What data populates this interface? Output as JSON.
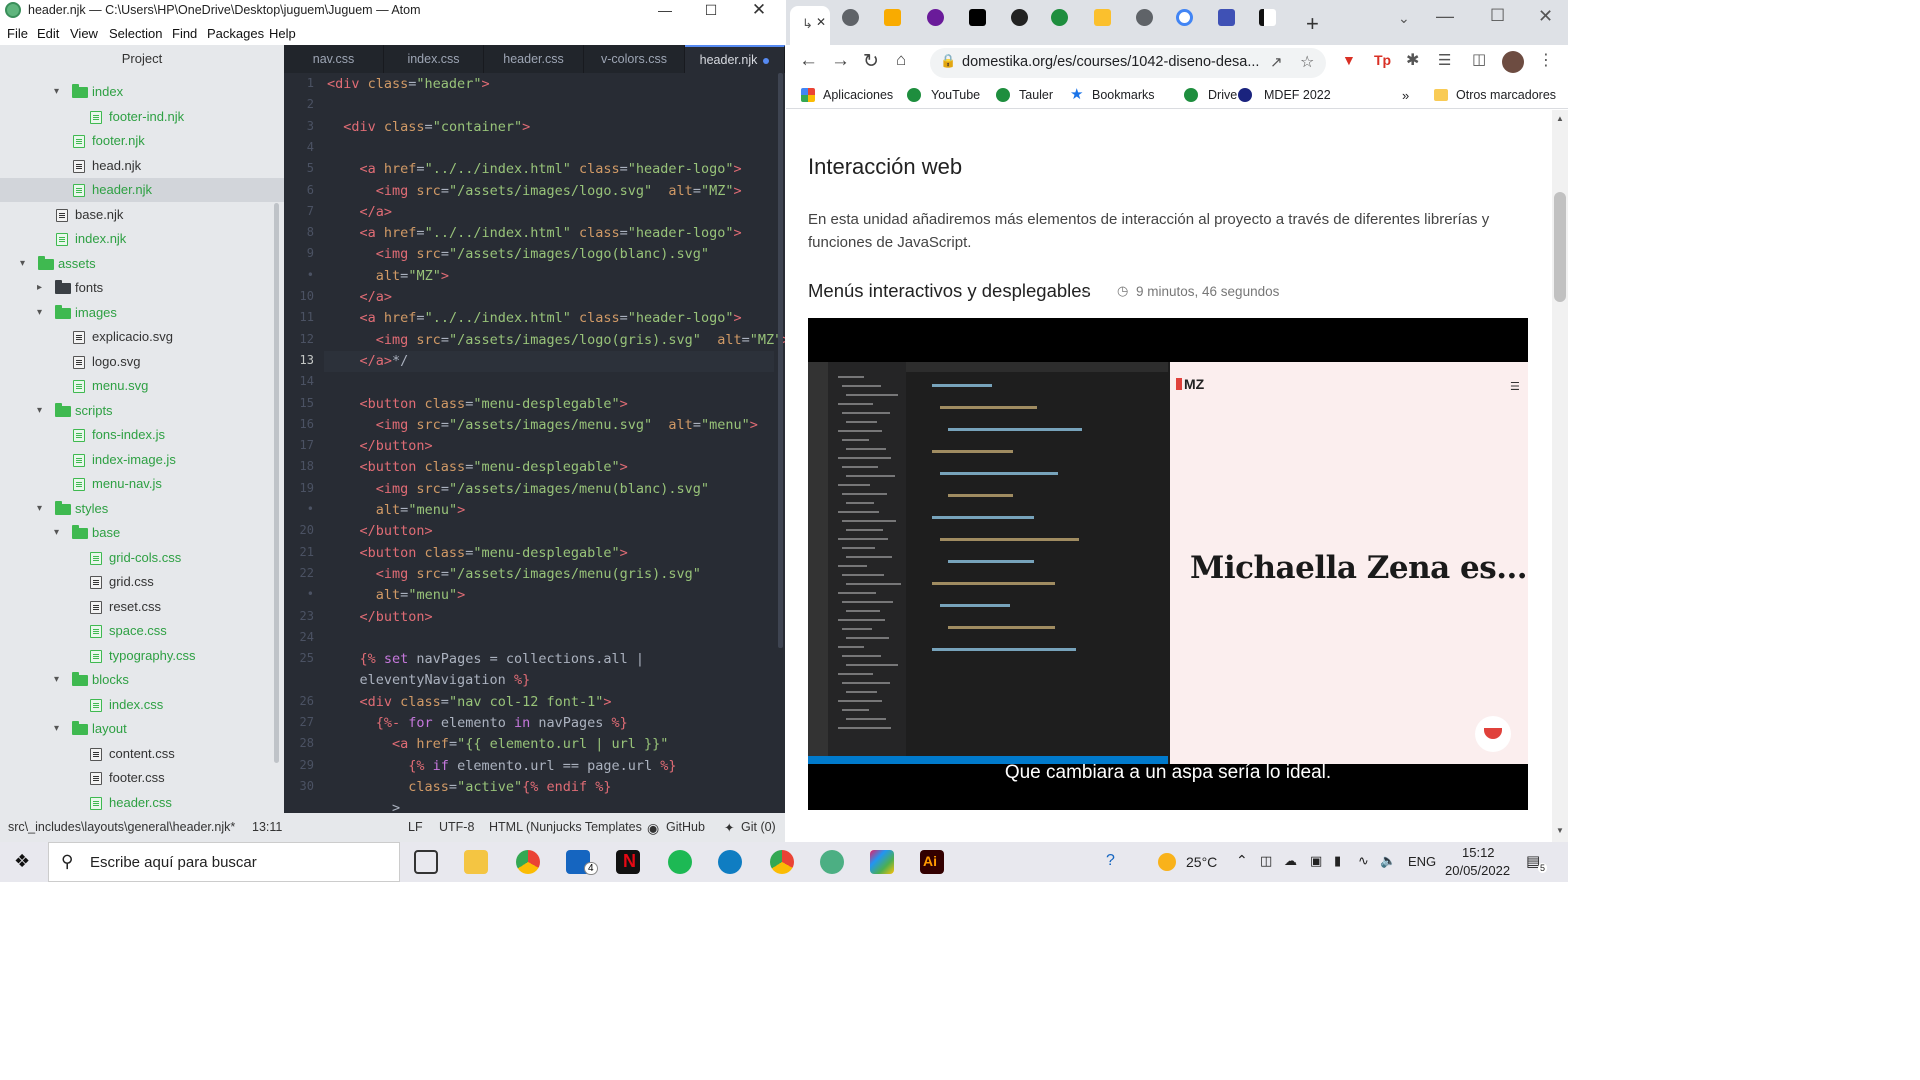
{
  "atom": {
    "title": "header.njk — C:\\Users\\HP\\OneDrive\\Desktop\\juguem\\Juguem — Atom",
    "menu": [
      "File",
      "Edit",
      "View",
      "Selection",
      "Find",
      "Packages",
      "Help"
    ],
    "tree_header": "Project",
    "tree": [
      {
        "label": "index",
        "kind": "dir",
        "open": true,
        "green": true,
        "indent": 2
      },
      {
        "label": "footer-ind.njk",
        "kind": "file",
        "green": true,
        "indent": 3
      },
      {
        "label": "footer.njk",
        "kind": "file",
        "green": true,
        "indent": 2
      },
      {
        "label": "head.njk",
        "kind": "file",
        "green": false,
        "indent": 2
      },
      {
        "label": "header.njk",
        "kind": "file",
        "green": true,
        "indent": 2,
        "selected": true
      },
      {
        "label": "base.njk",
        "kind": "file",
        "green": false,
        "indent": 1
      },
      {
        "label": "index.njk",
        "kind": "file",
        "green": true,
        "indent": 1
      },
      {
        "label": "assets",
        "kind": "dir",
        "open": true,
        "green": true,
        "indent": 0
      },
      {
        "label": "fonts",
        "kind": "dir",
        "open": false,
        "green": false,
        "indent": 1
      },
      {
        "label": "images",
        "kind": "dir",
        "open": true,
        "green": true,
        "indent": 1
      },
      {
        "label": "explicacio.svg",
        "kind": "file",
        "green": false,
        "indent": 2
      },
      {
        "label": "logo.svg",
        "kind": "file",
        "green": false,
        "indent": 2
      },
      {
        "label": "menu.svg",
        "kind": "file",
        "green": true,
        "indent": 2
      },
      {
        "label": "scripts",
        "kind": "dir",
        "open": true,
        "green": true,
        "indent": 1
      },
      {
        "label": "fons-index.js",
        "kind": "file",
        "green": true,
        "indent": 2
      },
      {
        "label": "index-image.js",
        "kind": "file",
        "green": true,
        "indent": 2
      },
      {
        "label": "menu-nav.js",
        "kind": "file",
        "green": true,
        "indent": 2
      },
      {
        "label": "styles",
        "kind": "dir",
        "open": true,
        "green": true,
        "indent": 1
      },
      {
        "label": "base",
        "kind": "dir",
        "open": true,
        "green": true,
        "indent": 2
      },
      {
        "label": "grid-cols.css",
        "kind": "file",
        "green": true,
        "indent": 3
      },
      {
        "label": "grid.css",
        "kind": "file",
        "green": false,
        "indent": 3
      },
      {
        "label": "reset.css",
        "kind": "file",
        "green": false,
        "indent": 3
      },
      {
        "label": "space.css",
        "kind": "file",
        "green": true,
        "indent": 3
      },
      {
        "label": "typography.css",
        "kind": "file",
        "green": true,
        "indent": 3
      },
      {
        "label": "blocks",
        "kind": "dir",
        "open": true,
        "green": true,
        "indent": 2
      },
      {
        "label": "index.css",
        "kind": "file",
        "green": true,
        "indent": 3
      },
      {
        "label": "layout",
        "kind": "dir",
        "open": true,
        "green": true,
        "indent": 2
      },
      {
        "label": "content.css",
        "kind": "file",
        "green": false,
        "indent": 3
      },
      {
        "label": "footer.css",
        "kind": "file",
        "green": false,
        "indent": 3
      },
      {
        "label": "header.css",
        "kind": "file",
        "green": true,
        "indent": 3
      }
    ],
    "tabs": [
      {
        "label": "nav.css",
        "active": false
      },
      {
        "label": "index.css",
        "active": false
      },
      {
        "label": "header.css",
        "active": false
      },
      {
        "label": "v-colors.css",
        "active": false
      },
      {
        "label": "header.njk",
        "active": true,
        "modified": true
      }
    ],
    "gutter": [
      "1",
      "2",
      "3",
      "4",
      "5",
      "6",
      "7",
      "8",
      "9",
      "•",
      "10",
      "11",
      "12",
      "13",
      "14",
      "15",
      "16",
      "17",
      "18",
      "19",
      "•",
      "20",
      "21",
      "22",
      "•",
      "23",
      "24",
      "25",
      "",
      "26",
      "27",
      "28",
      "29",
      "30"
    ],
    "code": [
      [
        [
          "tg",
          "<div "
        ],
        [
          "at",
          "class"
        ],
        [
          "pl",
          "="
        ],
        [
          "st",
          "\"header\""
        ],
        [
          "tg",
          ">"
        ]
      ],
      [],
      [
        [
          "pl",
          "  "
        ],
        [
          "tg",
          "<div "
        ],
        [
          "at",
          "class"
        ],
        [
          "pl",
          "="
        ],
        [
          "st",
          "\"container\""
        ],
        [
          "tg",
          ">"
        ]
      ],
      [],
      [
        [
          "pl",
          "    "
        ],
        [
          "tg",
          "<a "
        ],
        [
          "at",
          "href"
        ],
        [
          "pl",
          "="
        ],
        [
          "st",
          "\"../../index.html\""
        ],
        [
          "pl",
          " "
        ],
        [
          "at",
          "class"
        ],
        [
          "pl",
          "="
        ],
        [
          "st",
          "\"header-logo\""
        ],
        [
          "tg",
          ">"
        ]
      ],
      [
        [
          "pl",
          "      "
        ],
        [
          "tg",
          "<img "
        ],
        [
          "at",
          "src"
        ],
        [
          "pl",
          "="
        ],
        [
          "st",
          "\"/assets/images/logo.svg\""
        ],
        [
          "pl",
          "  "
        ],
        [
          "at",
          "alt"
        ],
        [
          "pl",
          "="
        ],
        [
          "st",
          "\"MZ\""
        ],
        [
          "tg",
          ">"
        ]
      ],
      [
        [
          "pl",
          "    "
        ],
        [
          "tg",
          "</a>"
        ]
      ],
      [
        [
          "pl",
          "    "
        ],
        [
          "tg",
          "<a "
        ],
        [
          "at",
          "href"
        ],
        [
          "pl",
          "="
        ],
        [
          "st",
          "\"../../index.html\""
        ],
        [
          "pl",
          " "
        ],
        [
          "at",
          "class"
        ],
        [
          "pl",
          "="
        ],
        [
          "st",
          "\"header-logo\""
        ],
        [
          "tg",
          ">"
        ]
      ],
      [
        [
          "pl",
          "      "
        ],
        [
          "tg",
          "<img "
        ],
        [
          "at",
          "src"
        ],
        [
          "pl",
          "="
        ],
        [
          "st",
          "\"/assets/images/logo(blanc).svg\""
        ]
      ],
      [
        [
          "pl",
          "      "
        ],
        [
          "at",
          "alt"
        ],
        [
          "pl",
          "="
        ],
        [
          "st",
          "\"MZ\""
        ],
        [
          "tg",
          ">"
        ]
      ],
      [
        [
          "pl",
          "    "
        ],
        [
          "tg",
          "</a>"
        ]
      ],
      [
        [
          "pl",
          "    "
        ],
        [
          "tg",
          "<a "
        ],
        [
          "at",
          "href"
        ],
        [
          "pl",
          "="
        ],
        [
          "st",
          "\"../../index.html\""
        ],
        [
          "pl",
          " "
        ],
        [
          "at",
          "class"
        ],
        [
          "pl",
          "="
        ],
        [
          "st",
          "\"header-logo\""
        ],
        [
          "tg",
          ">"
        ]
      ],
      [
        [
          "pl",
          "      "
        ],
        [
          "tg",
          "<img "
        ],
        [
          "at",
          "src"
        ],
        [
          "pl",
          "="
        ],
        [
          "st",
          "\"/assets/images/logo(gris).svg\""
        ],
        [
          "pl",
          "  "
        ],
        [
          "at",
          "alt"
        ],
        [
          "pl",
          "="
        ],
        [
          "st",
          "\"MZ\""
        ],
        [
          "tg",
          ">"
        ]
      ],
      [
        [
          "pl",
          "    "
        ],
        [
          "tg",
          "</a>"
        ],
        [
          "pl",
          "*/"
        ]
      ],
      [],
      [
        [
          "pl",
          "    "
        ],
        [
          "tg",
          "<button "
        ],
        [
          "at",
          "class"
        ],
        [
          "pl",
          "="
        ],
        [
          "st",
          "\"menu-desplegable\""
        ],
        [
          "tg",
          ">"
        ]
      ],
      [
        [
          "pl",
          "      "
        ],
        [
          "tg",
          "<img "
        ],
        [
          "at",
          "src"
        ],
        [
          "pl",
          "="
        ],
        [
          "st",
          "\"/assets/images/menu.svg\""
        ],
        [
          "pl",
          "  "
        ],
        [
          "at",
          "alt"
        ],
        [
          "pl",
          "="
        ],
        [
          "st",
          "\"menu\""
        ],
        [
          "tg",
          ">"
        ]
      ],
      [
        [
          "pl",
          "    "
        ],
        [
          "tg",
          "</button>"
        ]
      ],
      [
        [
          "pl",
          "    "
        ],
        [
          "tg",
          "<button "
        ],
        [
          "at",
          "class"
        ],
        [
          "pl",
          "="
        ],
        [
          "st",
          "\"menu-desplegable\""
        ],
        [
          "tg",
          ">"
        ]
      ],
      [
        [
          "pl",
          "      "
        ],
        [
          "tg",
          "<img "
        ],
        [
          "at",
          "src"
        ],
        [
          "pl",
          "="
        ],
        [
          "st",
          "\"/assets/images/menu(blanc).svg\""
        ]
      ],
      [
        [
          "pl",
          "      "
        ],
        [
          "at",
          "alt"
        ],
        [
          "pl",
          "="
        ],
        [
          "st",
          "\"menu\""
        ],
        [
          "tg",
          ">"
        ]
      ],
      [
        [
          "pl",
          "    "
        ],
        [
          "tg",
          "</button>"
        ]
      ],
      [
        [
          "pl",
          "    "
        ],
        [
          "tg",
          "<button "
        ],
        [
          "at",
          "class"
        ],
        [
          "pl",
          "="
        ],
        [
          "st",
          "\"menu-desplegable\""
        ],
        [
          "tg",
          ">"
        ]
      ],
      [
        [
          "pl",
          "      "
        ],
        [
          "tg",
          "<img "
        ],
        [
          "at",
          "src"
        ],
        [
          "pl",
          "="
        ],
        [
          "st",
          "\"/assets/images/menu(gris).svg\""
        ]
      ],
      [
        [
          "pl",
          "      "
        ],
        [
          "at",
          "alt"
        ],
        [
          "pl",
          "="
        ],
        [
          "st",
          "\"menu\""
        ],
        [
          "tg",
          ">"
        ]
      ],
      [
        [
          "pl",
          "    "
        ],
        [
          "tg",
          "</button>"
        ]
      ],
      [],
      [
        [
          "pl",
          "    "
        ],
        [
          "tg",
          "{% "
        ],
        [
          "kw",
          "set"
        ],
        [
          "pl",
          " navPages = collections.all |"
        ]
      ],
      [
        [
          "pl",
          "    eleventyNavigation "
        ],
        [
          "tg",
          "%}"
        ]
      ],
      [
        [
          "pl",
          "    "
        ],
        [
          "tg",
          "<div "
        ],
        [
          "at",
          "class"
        ],
        [
          "pl",
          "="
        ],
        [
          "st",
          "\"nav col-12 font-1\""
        ],
        [
          "tg",
          ">"
        ]
      ],
      [
        [
          "pl",
          "      "
        ],
        [
          "tg",
          "{%- "
        ],
        [
          "kw",
          "for"
        ],
        [
          "pl",
          " elemento "
        ],
        [
          "kw",
          "in"
        ],
        [
          "pl",
          " navPages "
        ],
        [
          "tg",
          "%}"
        ]
      ],
      [
        [
          "pl",
          "        "
        ],
        [
          "tg",
          "<a "
        ],
        [
          "at",
          "href"
        ],
        [
          "pl",
          "="
        ],
        [
          "st",
          "\"{{ elemento.url | url }}\""
        ]
      ],
      [
        [
          "pl",
          "          "
        ],
        [
          "tg",
          "{% "
        ],
        [
          "kw",
          "if"
        ],
        [
          "pl",
          " elemento.url == page.url "
        ],
        [
          "tg",
          "%}"
        ]
      ],
      [
        [
          "pl",
          "          "
        ],
        [
          "at",
          "class"
        ],
        [
          "pl",
          "="
        ],
        [
          "st",
          "\"active\""
        ],
        [
          "tg",
          "{% endif %}"
        ]
      ],
      [
        [
          "pl",
          "        >"
        ]
      ]
    ],
    "status": {
      "path": "src\\_includes\\layouts\\general\\header.njk*",
      "cursor": "13:11",
      "eol": "LF",
      "encoding": "UTF-8",
      "grammar": "HTML (Nunjucks Templates",
      "github": "GitHub",
      "git": "Git (0)"
    }
  },
  "chrome": {
    "url": "domestika.org/es/courses/1042-diseno-desa...",
    "bookmarks": [
      {
        "label": "Aplicaciones",
        "color": "#ea4335"
      },
      {
        "label": "YouTube",
        "color": "#1e8e3e"
      },
      {
        "label": "Tauler",
        "color": "#1e8e3e"
      },
      {
        "label": "Bookmarks",
        "color": "#1a73e8"
      },
      {
        "label": "Drive",
        "color": "#1e8e3e"
      },
      {
        "label": "MDEF 2022",
        "color": "#1a237e"
      }
    ],
    "other_bookmarks": "Otros marcadores",
    "page": {
      "section_title": "Interacción web",
      "intro": "En esta unidad añadiremos más elementos de interacción al proyecto a través de diferentes librerías y funciones de JavaScript.",
      "lesson_title": "Menús interactivos y desplegables",
      "duration": "9 minutos, 46 segundos",
      "video_logo": "MZ",
      "video_heading": "Michaella Zena es...",
      "subtitle": "Que cambiara a un aspa sería lo ideal."
    }
  },
  "taskbar": {
    "search_placeholder": "Escribe aquí para buscar",
    "temperature": "25°C",
    "lang": "ENG",
    "time": "15:12",
    "date": "20/05/2022",
    "notif_count": "5",
    "mail_badge": "4"
  }
}
